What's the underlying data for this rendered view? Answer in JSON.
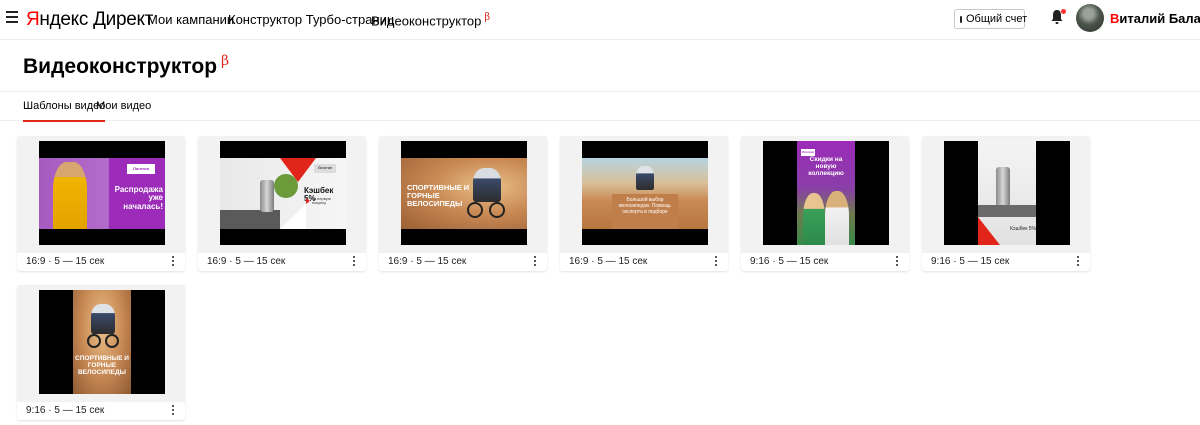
{
  "header": {
    "logo_brand": "Яндекс",
    "logo_product": "Директ",
    "nav": [
      "Мои кампании",
      "Конструктор Турбо-страниц",
      "Видеоконструктор"
    ],
    "beta_mark": "β",
    "account_button": "Общий счет",
    "user_first": "В",
    "user_rest": "италий Баландин"
  },
  "page": {
    "title": "Видеоконструктор",
    "beta_mark": "β"
  },
  "tabs": [
    {
      "label": "Шаблоны видео",
      "active": true
    },
    {
      "label": "Мои видео",
      "active": false
    }
  ],
  "templates": [
    {
      "meta": "16:9 · 5 — 15 сек",
      "overlay": "Распродажа уже началась!",
      "badge": "Логотип"
    },
    {
      "meta": "16:9 · 5 — 15 сек",
      "overlay": "Кэшбек 5%",
      "sub": "за первую покупку",
      "badge": "Логотип"
    },
    {
      "meta": "16:9 · 5 — 15 сек",
      "overlay": "СПОРТИВНЫЕ И ГОРНЫЕ ВЕЛОСИПЕДЫ"
    },
    {
      "meta": "16:9 · 5 — 15 сек",
      "overlay": "Большой выбор велосипедов. Помощь эксперта в подборе"
    },
    {
      "meta": "9:16 · 5 — 15 сек",
      "overlay": "Скидки на новую коллекцию",
      "badge": "Логотип"
    },
    {
      "meta": "9:16 · 5 — 15 сек",
      "overlay": "Кэшбек 5%"
    },
    {
      "meta": "9:16 · 5 — 15 сек",
      "overlay": "СПОРТИВНЫЕ И ГОРНЫЕ ВЕЛОСИПЕДЫ"
    }
  ],
  "colors": {
    "accent_red": "#e1251b",
    "promo_purple": "#9b2bb8",
    "card_bg": "#f2f2f2",
    "desert": "#c98a55"
  }
}
